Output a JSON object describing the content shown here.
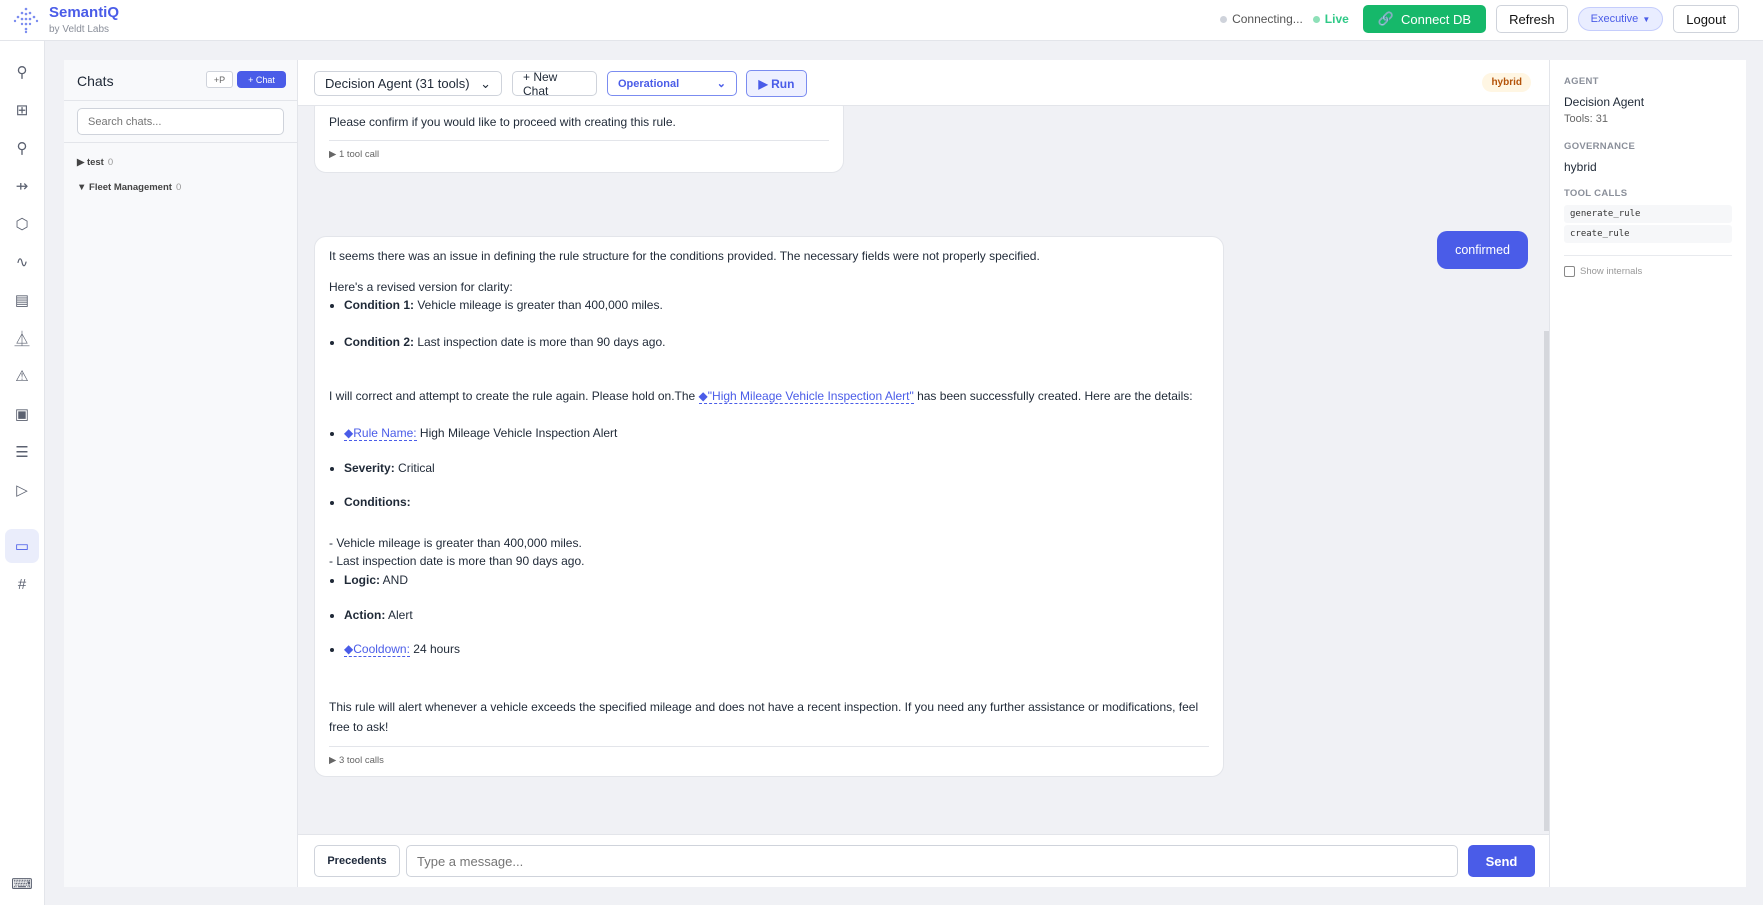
{
  "header": {
    "brand": "SemantiQ",
    "subtitle": "by Veldt Labs",
    "status_connecting": "Connecting...",
    "status_live": "Live",
    "connect_db": "Connect DB",
    "refresh": "Refresh",
    "role": "Executive",
    "logout": "Logout"
  },
  "colors": {
    "accent": "#4a5ce8",
    "green": "#16b86a",
    "live": "#2fc987"
  },
  "rail": [
    "graph-icon",
    "grid-icon",
    "graph-icon",
    "usb-icon",
    "hexagon-plus-icon",
    "activity-icon",
    "document-icon",
    "flask-icon",
    "warning-icon",
    "user-card-icon",
    "filter-list-icon",
    "play-icon",
    "chat-icon",
    "hash-icon",
    "terminal-icon"
  ],
  "chats": {
    "title": "Chats",
    "p_button": "+P",
    "new_chat": "+ Chat",
    "search_placeholder": "Search chats...",
    "groups": [
      {
        "name": "test",
        "count": "0"
      },
      {
        "name": "Fleet Management",
        "count": "0"
      }
    ]
  },
  "toolbar": {
    "agent": "Decision Agent (31 tools)",
    "new_chat": "+ New Chat",
    "mode": "Operational",
    "run": "▶ Run",
    "badge": "hybrid"
  },
  "messages": {
    "m1_text": "Please confirm if you would like to proceed with creating this rule.",
    "m1_tools": "1 tool call",
    "user": "confirmed",
    "m2": {
      "p1": "It seems there was an issue in defining the rule structure for the conditions provided. The necessary fields were not properly specified.",
      "p2": "Here's a revised version for clarity:",
      "c1_label": "Condition 1:",
      "c1": " Vehicle mileage is greater than 400,000 miles.",
      "c2_label": "Condition 2:",
      "c2": " Last inspection date is more than 90 days ago.",
      "p3a": "I will correct and attempt to create the rule again. Please hold on.The ",
      "p3_link": "\"High Mileage Vehicle Inspection Alert\"",
      "p3b": " has been successfully created. Here are the details:",
      "rn_label": "Rule Name:",
      "rn": " High Mileage Vehicle Inspection Alert",
      "sev_label": "Severity:",
      "sev": " Critical",
      "cond_label": "Conditions:",
      "d1": "- Vehicle mileage is greater than 400,000 miles.",
      "d2": "- Last inspection date is more than 90 days ago.",
      "logic_label": "Logic:",
      "logic": " AND",
      "action_label": "Action:",
      "action": " Alert",
      "cd_label": "Cooldown:",
      "cd": " 24 hours",
      "p4": "This rule will alert whenever a vehicle exceeds the specified mileage and does not have a recent inspection. If you need any further assistance or modifications, feel free to ask!",
      "tools": "3 tool calls"
    }
  },
  "input": {
    "precedents": "Precedents",
    "placeholder": "Type a message...",
    "send": "Send"
  },
  "panel": {
    "agent_label": "AGENT",
    "agent": "Decision Agent",
    "tools": "Tools: 31",
    "gov_label": "GOVERNANCE",
    "gov": "hybrid",
    "tc_label": "TOOL CALLS",
    "tool_calls": [
      "generate_rule",
      "create_rule"
    ],
    "show_internals": "Show internals"
  }
}
